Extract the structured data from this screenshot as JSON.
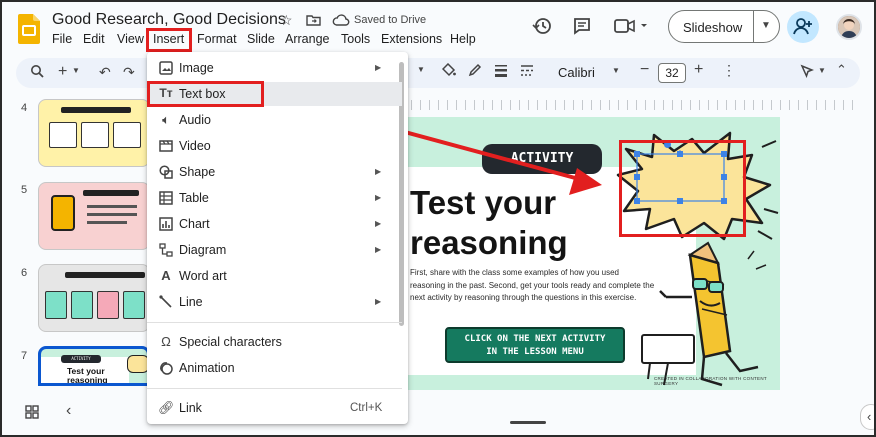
{
  "document": {
    "title": "Good Research, Good Decisions",
    "status": "Saved to Drive"
  },
  "menubar": [
    "File",
    "Edit",
    "View",
    "Insert",
    "Format",
    "Slide",
    "Arrange",
    "Tools",
    "Extensions",
    "Help"
  ],
  "header": {
    "slideshow_label": "Slideshow",
    "icons": [
      "history-icon",
      "comment-icon",
      "video-call-icon",
      "share-icon",
      "account-avatar"
    ]
  },
  "toolbar": {
    "font_name": "Calibri",
    "font_size": "32",
    "minus": "−",
    "plus": "+"
  },
  "insert_menu": {
    "items": [
      {
        "icon": "image-icon",
        "label": "Image",
        "submenu": true
      },
      {
        "icon": "text-box-icon",
        "label": "Text box",
        "submenu": false
      },
      {
        "icon": "audio-icon",
        "label": "Audio",
        "submenu": false
      },
      {
        "icon": "video-icon",
        "label": "Video",
        "submenu": false
      },
      {
        "icon": "shape-icon",
        "label": "Shape",
        "submenu": true
      },
      {
        "icon": "table-icon",
        "label": "Table",
        "submenu": true
      },
      {
        "icon": "chart-icon",
        "label": "Chart",
        "submenu": true
      },
      {
        "icon": "diagram-icon",
        "label": "Diagram",
        "submenu": true
      },
      {
        "icon": "word-art-icon",
        "label": "Word art",
        "submenu": false
      },
      {
        "icon": "line-icon",
        "label": "Line",
        "submenu": true
      },
      {
        "icon": "special-characters-icon",
        "label": "Special characters",
        "submenu": false
      },
      {
        "icon": "animation-icon",
        "label": "Animation",
        "submenu": false
      },
      {
        "icon": "link-icon",
        "label": "Link",
        "submenu": false,
        "shortcut": "Ctrl+K"
      }
    ]
  },
  "filmstrip": {
    "slides": [
      {
        "number": "4",
        "theme": "#fff2a8"
      },
      {
        "number": "5",
        "theme": "#f8d1d1"
      },
      {
        "number": "6",
        "theme": "#e6e6e6"
      },
      {
        "number": "7",
        "theme": "#ffffff",
        "title": "Test your reasoning",
        "pill": "ACTIVITY"
      }
    ]
  },
  "slide": {
    "activity_label": "ACTIVITY",
    "title_line1": "Test your",
    "title_line2": "reasoning",
    "body": "First, share with the class some examples of how you used reasoning in the past. Second, get your tools ready and complete the next activity by reasoning through the questions in this exercise.",
    "cta_line1": "CLICK ON THE NEXT ACTIVITY",
    "cta_line2": "IN THE LESSON MENU",
    "credit": "CREATED IN COLLABORATION WITH CONTENT SURGERY",
    "colors": {
      "background": "#c8f0dd",
      "button": "#157a5f",
      "burst": "#fbe49a"
    }
  },
  "annotations": {
    "highlight_color": "#e21f1f"
  }
}
